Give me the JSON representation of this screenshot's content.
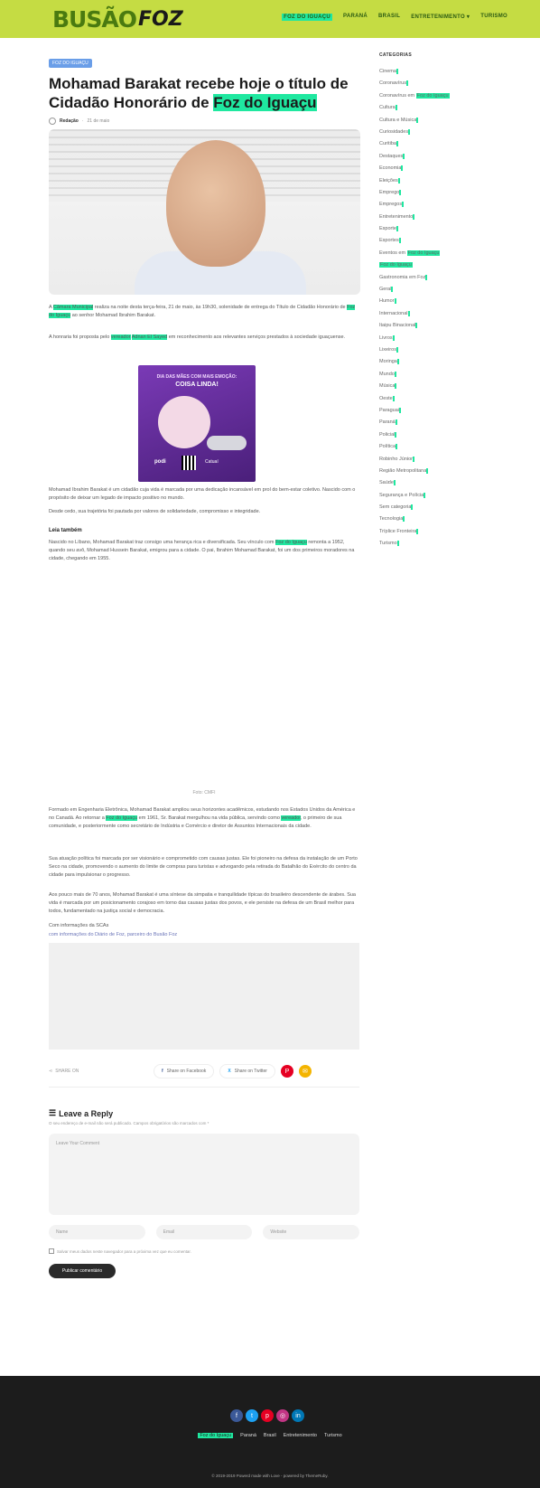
{
  "header": {
    "logo_main": "BUSÃO",
    "logo_sub": "FOZ",
    "nav": [
      {
        "label": "FOZ DO IGUAÇU",
        "highlight": true
      },
      {
        "label": "PARANÁ",
        "highlight": false
      },
      {
        "label": "BRASIL",
        "highlight": false
      },
      {
        "label": "ENTRETENIMENTO ▾",
        "highlight": false
      },
      {
        "label": "TURISMO",
        "highlight": false
      }
    ]
  },
  "article": {
    "category": "FOZ DO IGUAÇU",
    "title_part1": "Mohamad Barakat recebe hoje o título de Cidadão Honorário de ",
    "title_highlight": "Foz do Iguaçu",
    "author": "Redação",
    "date": "21 de maio",
    "p1_a": "A ",
    "p1_hl1": "Câmara Municipal",
    "p1_b": " realiza na noite desta terça-feira, 21 de maio, às 19h30, solenidade de entrega do Título de Cidadão Honorário de ",
    "p1_hl2": "Foz do Iguaçu",
    "p1_c": " ao senhor Mohamad Ibrahim Barakat.",
    "p2_a": "A honraria foi proposta pelo ",
    "p2_hl1": "vereador",
    "p2_hl2": "Adnan El Sayed",
    "p2_b": " em reconhecimento aos relevantes serviços prestados à sociedade iguaçuense.",
    "ad": {
      "top": "DIA DAS MÃES COM MAIS EMOÇÃO:",
      "big": "COISA LINDA!",
      "brand1": "podi",
      "brand2": "Catuaí"
    },
    "p3": "Mohamad Ibrahim Barakat é um cidadão cuja vida é marcada por uma dedicação incansável em prol do bem-estar coletivo. Nascido com o propósito de deixar um legado de impacto positivo no mundo.",
    "p4": "Desde cedo, sua trajetória foi pautada por valores de solidariedade, compromisso e integridade.",
    "read_also": "Leia também",
    "p5_a": "Nascido no Líbano, Mohamad Barakat traz consigo uma herança rica e diversificada. Seu vínculo com ",
    "p5_hl": "Foz do Iguaçu",
    "p5_b": " remonta a 1952, quando seu avô, Mohamad Hussein Barakat, emigrou para a cidade. O pai, Ibrahim Mohamad Barakat, foi um dos primeiros moradores na cidade, chegando em 1955.",
    "fig_caption": "Foto: CMFI",
    "p6_a": "Formado em Engenharia Eletrônica, Mohamad Barakat ampliou seus horizontes acadêmicos, estudando nos Estados Unidos da América e no Canadá. Ao retornar a ",
    "p6_hl1": "Foz do Iguaçu",
    "p6_b": " em 1961, Sr. Barakat mergulhou na vida pública, servindo como ",
    "p6_hl2": "vereador",
    "p6_c": ", o primeiro de sua comunidade, e posteriormente como secretário de Indústria e Comércio e diretor de Assuntos Internacionais da cidade.",
    "p7": "Sua atuação política foi marcada por ser visionário e comprometido com causas justas. Ele foi pioneiro na defesa da instalação de um Porto Seco na cidade, promovendo o aumento do limite de compras para turistas e advogando pela retirada do Batalhão do Exército do centro da cidade para impulsionar o progresso.",
    "p8": "Aos pouco mais de 70 anos, Mohamad Barakat é uma síntese da simpatia e tranquilidade típicas do brasileiro descendente de árabes. Sua vida é marcada por um posicionamento corajoso em torno das causas justas dos povos, e ele persiste na defesa de um Brasil melhor para todos, fundamentado na justiça social e democracia.",
    "p9": "Com informações da SCAs",
    "p10": "com informações do Diário de Foz, parceiro do Busão Foz"
  },
  "share": {
    "label": "SHARE ON",
    "facebook": "Share on Facebook",
    "twitter": "Share on Twitter"
  },
  "reply": {
    "title": "Leave a Reply",
    "note": "O seu endereço de e-mail não será publicado. Campos obrigatórios são marcados com *",
    "comment_placeholder": "Leave Your Comment",
    "name_placeholder": "Name",
    "email_placeholder": "Email",
    "website_placeholder": "Website",
    "checkbox_label": "Salvar meus dados neste navegador para a próxima vez que eu comentar.",
    "submit": "Publicar comentário"
  },
  "sidebar": {
    "title": "CATEGORIAS",
    "items": [
      {
        "a": "Cinema",
        "hl": "",
        "b": ""
      },
      {
        "a": "Coronavírus",
        "hl": "",
        "b": ""
      },
      {
        "a": "Coronavírus em ",
        "hl": "Foz do Iguaçu",
        "b": ""
      },
      {
        "a": "Cultura",
        "hl": "",
        "b": ""
      },
      {
        "a": "Cultura e Música",
        "hl": "",
        "b": ""
      },
      {
        "a": "Curiosidades",
        "hl": "",
        "b": ""
      },
      {
        "a": "Curitiba",
        "hl": "",
        "b": ""
      },
      {
        "a": "Destaques",
        "hl": "",
        "b": ""
      },
      {
        "a": "Economia",
        "hl": "",
        "b": ""
      },
      {
        "a": "Eleições",
        "hl": "",
        "b": ""
      },
      {
        "a": "Emprego",
        "hl": "",
        "b": ""
      },
      {
        "a": "Empregos",
        "hl": "",
        "b": ""
      },
      {
        "a": "Entretenimento",
        "hl": "",
        "b": ""
      },
      {
        "a": "Esporte",
        "hl": "",
        "b": ""
      },
      {
        "a": "Esportes",
        "hl": "",
        "b": ""
      },
      {
        "a": "Eventos em ",
        "hl": "Foz do Iguaçu",
        "b": ""
      },
      {
        "a": "",
        "hl": "Foz do Iguaçu",
        "b": ""
      },
      {
        "a": "Gastronomia em Foz",
        "hl": "",
        "b": ""
      },
      {
        "a": "Geral",
        "hl": "",
        "b": ""
      },
      {
        "a": "Humor",
        "hl": "",
        "b": ""
      },
      {
        "a": "Internacional",
        "hl": "",
        "b": ""
      },
      {
        "a": "Itaipu Binacional",
        "hl": "",
        "b": ""
      },
      {
        "a": "Livros",
        "hl": "",
        "b": ""
      },
      {
        "a": "Lixeiros",
        "hl": "",
        "b": ""
      },
      {
        "a": "Moringa",
        "hl": "",
        "b": ""
      },
      {
        "a": "Mundo",
        "hl": "",
        "b": ""
      },
      {
        "a": "Música",
        "hl": "",
        "b": ""
      },
      {
        "a": "Oeste",
        "hl": "",
        "b": ""
      },
      {
        "a": "Paraguai",
        "hl": "",
        "b": ""
      },
      {
        "a": "Paraná",
        "hl": "",
        "b": ""
      },
      {
        "a": "Policial",
        "hl": "",
        "b": ""
      },
      {
        "a": "Política",
        "hl": "",
        "b": ""
      },
      {
        "a": "Robinho Júnior",
        "hl": "",
        "b": ""
      },
      {
        "a": "Região Metropolitana",
        "hl": "",
        "b": ""
      },
      {
        "a": "Saúde",
        "hl": "",
        "b": ""
      },
      {
        "a": "Segurança e Polícia",
        "hl": "",
        "b": ""
      },
      {
        "a": "Sem categoria",
        "hl": "",
        "b": ""
      },
      {
        "a": "Tecnologia",
        "hl": "",
        "b": ""
      },
      {
        "a": "Tríplice Fronteira",
        "hl": "",
        "b": ""
      },
      {
        "a": "Turismo",
        "hl": "",
        "b": ""
      }
    ]
  },
  "footer": {
    "icons": [
      "facebook-icon",
      "twitter-icon",
      "pinterest-icon",
      "instagram-icon",
      "linkedin-icon"
    ],
    "icon_colors": [
      "#3b5998",
      "#1da1f2",
      "#e60023",
      "#c13584",
      "#0077b5"
    ],
    "nav_hl": "Foz do Iguaçu",
    "nav": [
      "Paraná",
      "Brasil",
      "Entretenimento",
      "Turismo"
    ],
    "copyright": "© 2019-2019 Powerd made with Love - powered by ThemeRuby."
  },
  "colors": {
    "header_bg": "#c5dc43",
    "highlight": "#1fe8a0",
    "footer_bg": "#1c1c1c"
  }
}
